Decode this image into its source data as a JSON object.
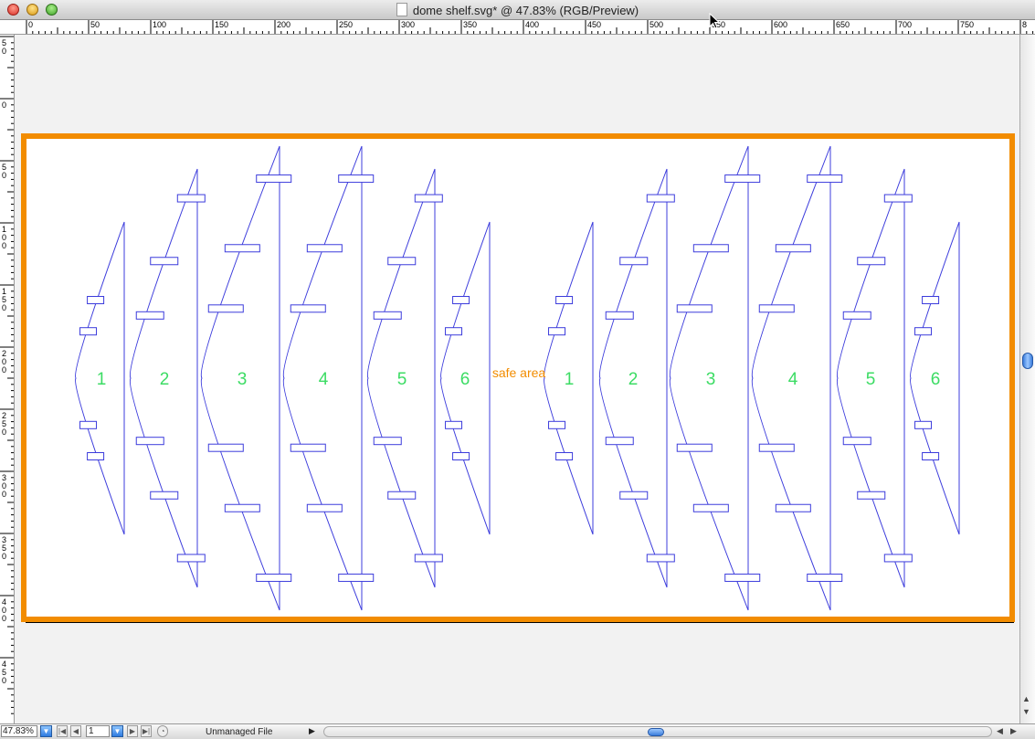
{
  "window": {
    "title": "dome shelf.svg* @ 47.83% (RGB/Preview)"
  },
  "rulers": {
    "horizontal": [
      "0",
      "50",
      "100",
      "150",
      "200",
      "250",
      "300",
      "350",
      "400",
      "450",
      "500",
      "550",
      "600",
      "650",
      "700",
      "750",
      "8"
    ],
    "vertical": [
      "50",
      "0",
      "50",
      "100",
      "150",
      "200",
      "250",
      "300",
      "350",
      "400",
      "450"
    ]
  },
  "artboard": {
    "border_color": "#f28c00",
    "stroke_color": "#3c3cdc",
    "number_color": "#3cdc64",
    "safe_area_label": "safe area",
    "left_group_labels": [
      "1",
      "2",
      "3",
      "4",
      "5",
      "6"
    ],
    "right_group_labels": [
      "1",
      "2",
      "3",
      "4",
      "5",
      "6"
    ]
  },
  "statusbar": {
    "zoom": "47.83%",
    "page": "1",
    "status_text": "Unmanaged File"
  },
  "icons": {
    "close": "close-icon",
    "minimize": "minimize-icon",
    "zoom": "zoom-icon",
    "document": "document-icon",
    "cursor": "cursor-arrow-icon"
  }
}
